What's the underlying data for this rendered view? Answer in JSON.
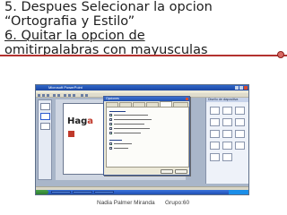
{
  "slide": {
    "lines": [
      "5. Despues Selecionar la opcion",
      "“Ortografia y Estilo”",
      "6. Quitar la opcion de",
      "omitirpalabras con mayusculas"
    ],
    "accent_color": "#b3322f"
  },
  "screenshot": {
    "app_title": "Microsoft PowerPoint",
    "dialog_title": "Opciones",
    "task_pane_title": "Diseño de diapositiva",
    "slide_title_parts": [
      "Hag",
      "a"
    ],
    "icons": [
      "app-logo-icon",
      "close-icon",
      "start-button-icon"
    ]
  },
  "footer": {
    "author": "Nadia Palmer Miranda",
    "group": "Grupo:60"
  }
}
